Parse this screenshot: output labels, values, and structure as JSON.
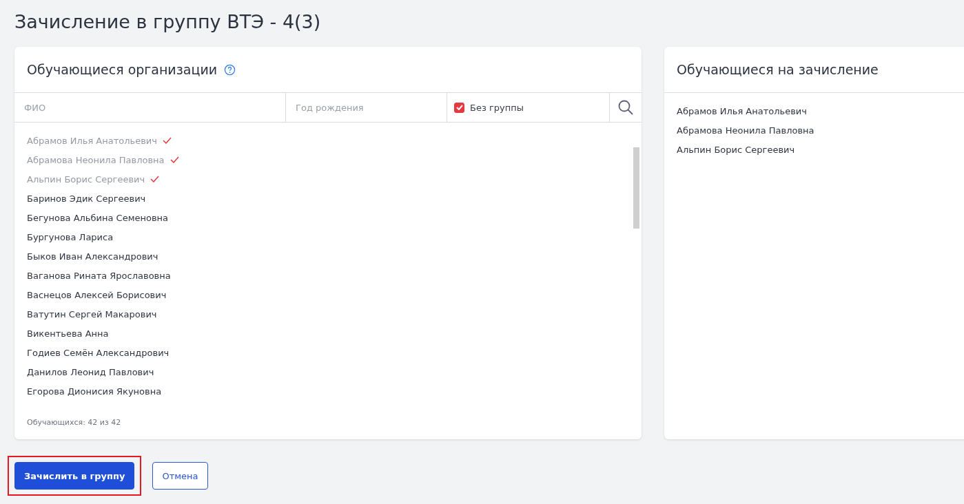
{
  "title": "Зачисление в группу ВТЭ - 4(3)",
  "left_panel": {
    "title": "Обучающиеся организации",
    "filters": {
      "name_placeholder": "ФИО",
      "birth_year_placeholder": "Год рождения",
      "no_group": {
        "label": "Без группы",
        "checked": true
      }
    },
    "students": [
      {
        "name": "Абрамов Илья Анатольевич",
        "enrolled": true
      },
      {
        "name": "Абрамова Неонила Павловна",
        "enrolled": true
      },
      {
        "name": "Альпин Борис Сергеевич",
        "enrolled": true
      },
      {
        "name": "Баринов Эдик Сергеевич",
        "enrolled": false
      },
      {
        "name": "Бегунова Альбина Семеновна",
        "enrolled": false
      },
      {
        "name": "Бургунова Лариса",
        "enrolled": false
      },
      {
        "name": "Быков Иван Александрович",
        "enrolled": false
      },
      {
        "name": "Ваганова Рината Ярославовна",
        "enrolled": false
      },
      {
        "name": "Васнецов Алексей Борисович",
        "enrolled": false
      },
      {
        "name": "Ватутин Сергей Макарович",
        "enrolled": false
      },
      {
        "name": "Викентьева Анна",
        "enrolled": false
      },
      {
        "name": "Годиев Семён Александрович",
        "enrolled": false
      },
      {
        "name": "Данилов Леонид Павлович",
        "enrolled": false
      },
      {
        "name": "Егорова Дионисия Якуновна",
        "enrolled": false
      }
    ],
    "count": "Обучающихся: 42 из 42"
  },
  "right_panel": {
    "title": "Обучающиеся на зачисление",
    "students": [
      "Абрамов Илья Анатольевич",
      "Абрамова Неонила Павловна",
      "Альпин Борис Сергеевич"
    ]
  },
  "buttons": [
    {
      "label": "Зачислить в группу",
      "kind": "primary",
      "highlighted": true
    },
    {
      "label": "Отмена",
      "kind": "secondary",
      "highlighted": false
    }
  ]
}
